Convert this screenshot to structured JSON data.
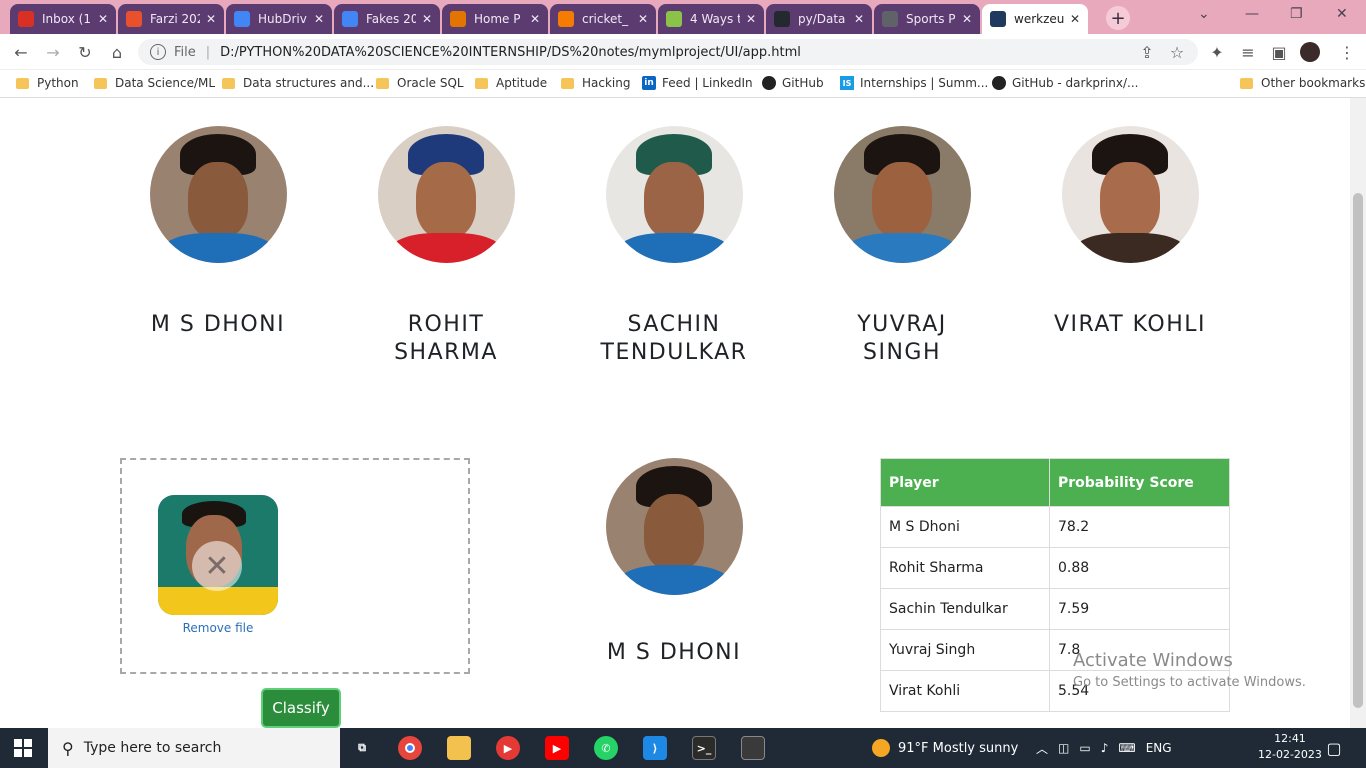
{
  "browser": {
    "tabs": [
      {
        "title": "Inbox (1",
        "favicon_color": "#d93025",
        "state": "inactive"
      },
      {
        "title": "Farzi 202",
        "favicon_color": "#e8512b",
        "state": "inactive"
      },
      {
        "title": "HubDriv",
        "favicon_color": "#4285f4",
        "state": "inactive"
      },
      {
        "title": "Fakes 20",
        "favicon_color": "#4285f4",
        "state": "inactive"
      },
      {
        "title": "Home P",
        "favicon_color": "#e37400",
        "state": "inactive"
      },
      {
        "title": "cricket_",
        "favicon_color": "#f57c00",
        "state": "inactive"
      },
      {
        "title": "4 Ways t",
        "favicon_color": "#8bc34a",
        "state": "inactive"
      },
      {
        "title": "py/Data",
        "favicon_color": "#24292f",
        "state": "inactive"
      },
      {
        "title": "Sports P",
        "favicon_color": "#5f6368",
        "state": "inactive"
      },
      {
        "title": "werkzeu",
        "favicon_color": "#1f3a5f",
        "state": "active"
      }
    ],
    "address": {
      "scheme_label": "File",
      "url": "D:/PYTHON%20DATA%20SCIENCE%20INTERNSHIP/DS%20notes/mymlproject/UI/app.html"
    },
    "bookmarks": [
      {
        "label": "Python",
        "icon": "folder-icon"
      },
      {
        "label": "Data Science/ML",
        "icon": "folder-icon"
      },
      {
        "label": "Data structures and...",
        "icon": "folder-icon"
      },
      {
        "label": "Oracle SQL",
        "icon": "folder-icon"
      },
      {
        "label": "Aptitude",
        "icon": "folder-icon"
      },
      {
        "label": "Hacking",
        "icon": "folder-icon"
      },
      {
        "label": "Feed | LinkedIn",
        "icon": "linkedin-icon"
      },
      {
        "label": "GitHub",
        "icon": "github-icon"
      },
      {
        "label": "Internships | Summ...",
        "icon": "internshala-icon"
      },
      {
        "label": "GitHub - darkprinx/...",
        "icon": "github-icon"
      },
      {
        "label": "Other bookmarks",
        "icon": "folder-icon"
      }
    ],
    "accent": "#e9a9bd"
  },
  "players": [
    {
      "name": "M S DHONI",
      "skin": "#8a5a3c",
      "hair": "#1b1410",
      "jersey": "#1f6fb8",
      "bg": "#9a8270"
    },
    {
      "name": "ROHIT SHARMA",
      "skin": "#a56a48",
      "hair": "#1e3a7a",
      "jersey": "#d8202a",
      "bg": "#d9cfc4"
    },
    {
      "name": "SACHIN TENDULKAR",
      "skin": "#9b6446",
      "hair": "#1f5a4a",
      "jersey": "#1f6fb8",
      "bg": "#e8e6e2"
    },
    {
      "name": "YUVRAJ SINGH",
      "skin": "#9c6240",
      "hair": "#1b1410",
      "jersey": "#2a7ac0",
      "bg": "#8a7a68"
    },
    {
      "name": "VIRAT KOHLI",
      "skin": "#a86b4c",
      "hair": "#1b1410",
      "jersey": "#3a2a22",
      "bg": "#e9e4df"
    }
  ],
  "upload": {
    "remove_label": "Remove file",
    "remove_icon": "close-icon"
  },
  "classify_label": "Classify",
  "result": {
    "name": "M S DHONI"
  },
  "table": {
    "headers": [
      "Player",
      "Probability Score"
    ],
    "rows": [
      [
        "M S Dhoni",
        "78.2"
      ],
      [
        "Rohit Sharma",
        "0.88"
      ],
      [
        "Sachin Tendulkar",
        "7.59"
      ],
      [
        "Yuvraj Singh",
        "7.8"
      ],
      [
        "Virat Kohli",
        "5.54"
      ]
    ],
    "header_color": "#4caf50"
  },
  "watermark": {
    "title": "Activate Windows",
    "subtitle": "Go to Settings to activate Windows."
  },
  "taskbar": {
    "search_placeholder": "Type here to search",
    "weather": "91°F  Mostly sunny",
    "language": "ENG",
    "time": "12:41",
    "date": "12-02-2023"
  }
}
